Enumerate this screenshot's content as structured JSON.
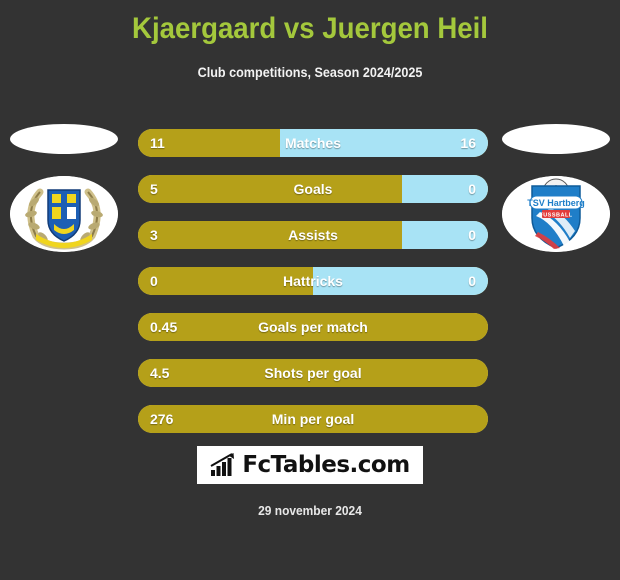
{
  "header": {
    "title": "Kjaergaard vs Juergen Heil",
    "subtitle": "Club competitions, Season 2024/2025",
    "title_color": "#a4c83c",
    "subtitle_color": "#f2f2f2"
  },
  "colors": {
    "background": "#333333",
    "home_bar": "#b5a019",
    "away_bar": "#a8e3f5",
    "bar_text": "#ffffff"
  },
  "badges": {
    "left": {
      "name": "home-club-crest",
      "description": "Blue and yellow shield with laurel wreath"
    },
    "right": {
      "name": "tsv-hartberg-crest",
      "line1": "TSV Hartberg",
      "line2": "FUSSBALL"
    }
  },
  "chart_data": {
    "type": "bar",
    "title": "Kjaergaard vs Juergen Heil",
    "subtitle": "Club competitions, Season 2024/2025",
    "orientation": "horizontal-diverging",
    "series": [
      {
        "name": "Kjaergaard",
        "color": "#b5a019"
      },
      {
        "name": "Juergen Heil",
        "color": "#a8e3f5"
      }
    ],
    "categories": [
      "Matches",
      "Goals",
      "Assists",
      "Hattricks",
      "Goals per match",
      "Shots per goal",
      "Min per goal"
    ],
    "rows": [
      {
        "label": "Matches",
        "home": "11",
        "away": "16",
        "home_pct": 40.7,
        "split": true
      },
      {
        "label": "Goals",
        "home": "5",
        "away": "0",
        "home_pct": 75.5,
        "split": true
      },
      {
        "label": "Assists",
        "home": "3",
        "away": "0",
        "home_pct": 75.5,
        "split": true
      },
      {
        "label": "Hattricks",
        "home": "0",
        "away": "0",
        "home_pct": 50.0,
        "split": true
      },
      {
        "label": "Goals per match",
        "home": "0.45",
        "away": "",
        "home_pct": 100,
        "split": false
      },
      {
        "label": "Shots per goal",
        "home": "4.5",
        "away": "",
        "home_pct": 100,
        "split": false
      },
      {
        "label": "Min per goal",
        "home": "276",
        "away": "",
        "home_pct": 100,
        "split": false
      }
    ]
  },
  "footer": {
    "logo_text": "FcTables.com",
    "logo_icon": "bar-chart-icon",
    "date": "29 november 2024"
  }
}
